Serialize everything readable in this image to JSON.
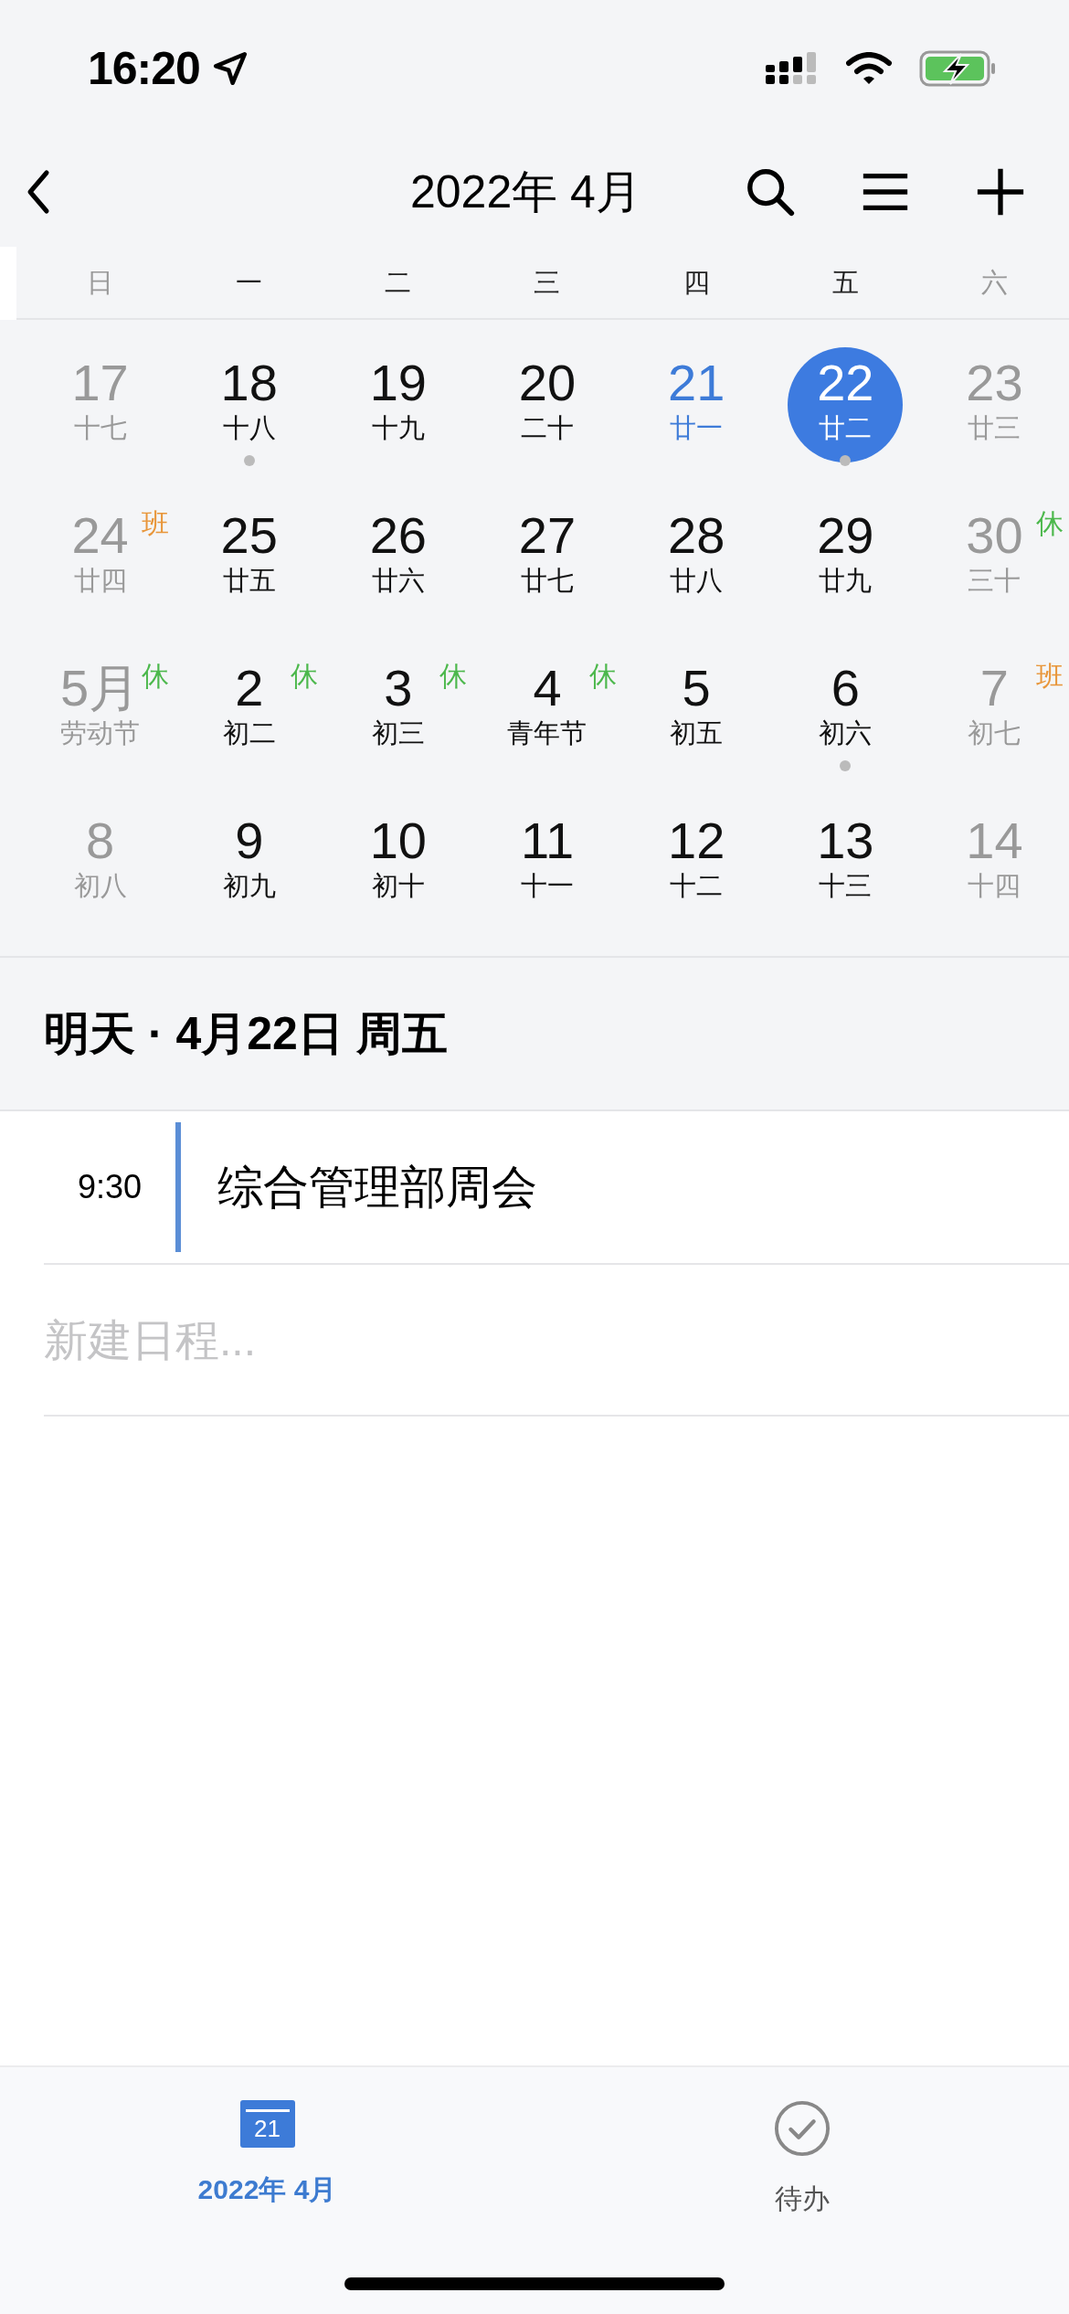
{
  "status_bar": {
    "time": "16:20"
  },
  "nav_bar": {
    "title": "2022年 4月"
  },
  "weekdays": [
    {
      "label": "日",
      "muted": true
    },
    {
      "label": "一",
      "muted": false
    },
    {
      "label": "二",
      "muted": false
    },
    {
      "label": "三",
      "muted": false
    },
    {
      "label": "四",
      "muted": false
    },
    {
      "label": "五",
      "muted": false
    },
    {
      "label": "六",
      "muted": true
    }
  ],
  "weeks": [
    [
      {
        "day": "17",
        "lunar": "十七",
        "muted": true,
        "today": false,
        "selected": false,
        "has_event": false
      },
      {
        "day": "18",
        "lunar": "十八",
        "muted": false,
        "today": false,
        "selected": false,
        "has_event": true
      },
      {
        "day": "19",
        "lunar": "十九",
        "muted": false,
        "today": false,
        "selected": false,
        "has_event": false
      },
      {
        "day": "20",
        "lunar": "二十",
        "muted": false,
        "today": false,
        "selected": false,
        "has_event": false
      },
      {
        "day": "21",
        "lunar": "廿一",
        "muted": false,
        "today": true,
        "selected": false,
        "has_event": false
      },
      {
        "day": "22",
        "lunar": "廿二",
        "muted": false,
        "today": false,
        "selected": true,
        "has_event": true
      },
      {
        "day": "23",
        "lunar": "廿三",
        "muted": true,
        "today": false,
        "selected": false,
        "has_event": false
      }
    ],
    [
      {
        "day": "24",
        "lunar": "廿四",
        "muted": true,
        "today": false,
        "selected": false,
        "has_event": false,
        "badge": {
          "text": "班",
          "color": "#e8963a"
        }
      },
      {
        "day": "25",
        "lunar": "廿五",
        "muted": false,
        "today": false,
        "selected": false,
        "has_event": false
      },
      {
        "day": "26",
        "lunar": "廿六",
        "muted": false,
        "today": false,
        "selected": false,
        "has_event": false
      },
      {
        "day": "27",
        "lunar": "廿七",
        "muted": false,
        "today": false,
        "selected": false,
        "has_event": false
      },
      {
        "day": "28",
        "lunar": "廿八",
        "muted": false,
        "today": false,
        "selected": false,
        "has_event": false
      },
      {
        "day": "29",
        "lunar": "廿九",
        "muted": false,
        "today": false,
        "selected": false,
        "has_event": false
      },
      {
        "day": "30",
        "lunar": "三十",
        "muted": true,
        "today": false,
        "selected": false,
        "has_event": false,
        "badge": {
          "text": "休",
          "color": "#4cb84c"
        }
      }
    ],
    [
      {
        "day": "5月",
        "lunar": "劳动节",
        "muted": true,
        "today": false,
        "selected": false,
        "has_event": false,
        "badge": {
          "text": "休",
          "color": "#4cb84c"
        }
      },
      {
        "day": "2",
        "lunar": "初二",
        "muted": false,
        "today": false,
        "selected": false,
        "has_event": false,
        "badge": {
          "text": "休",
          "color": "#4cb84c"
        }
      },
      {
        "day": "3",
        "lunar": "初三",
        "muted": false,
        "today": false,
        "selected": false,
        "has_event": false,
        "badge": {
          "text": "休",
          "color": "#4cb84c"
        }
      },
      {
        "day": "4",
        "lunar": "青年节",
        "muted": false,
        "today": false,
        "selected": false,
        "has_event": false,
        "badge": {
          "text": "休",
          "color": "#4cb84c"
        }
      },
      {
        "day": "5",
        "lunar": "初五",
        "muted": false,
        "today": false,
        "selected": false,
        "has_event": false
      },
      {
        "day": "6",
        "lunar": "初六",
        "muted": false,
        "today": false,
        "selected": false,
        "has_event": true
      },
      {
        "day": "7",
        "lunar": "初七",
        "muted": true,
        "today": false,
        "selected": false,
        "has_event": false,
        "badge": {
          "text": "班",
          "color": "#e8963a"
        }
      }
    ],
    [
      {
        "day": "8",
        "lunar": "初八",
        "muted": true,
        "today": false,
        "selected": false,
        "has_event": false
      },
      {
        "day": "9",
        "lunar": "初九",
        "muted": false,
        "today": false,
        "selected": false,
        "has_event": false
      },
      {
        "day": "10",
        "lunar": "初十",
        "muted": false,
        "today": false,
        "selected": false,
        "has_event": false
      },
      {
        "day": "11",
        "lunar": "十一",
        "muted": false,
        "today": false,
        "selected": false,
        "has_event": false
      },
      {
        "day": "12",
        "lunar": "十二",
        "muted": false,
        "today": false,
        "selected": false,
        "has_event": false
      },
      {
        "day": "13",
        "lunar": "十三",
        "muted": false,
        "today": false,
        "selected": false,
        "has_event": false
      },
      {
        "day": "14",
        "lunar": "十四",
        "muted": true,
        "today": false,
        "selected": false,
        "has_event": false
      }
    ]
  ],
  "agenda": {
    "heading": "明天 · 4月22日 周五",
    "events": [
      {
        "time": "9:30",
        "title": "综合管理部周会",
        "color": "#5b8ed6"
      }
    ],
    "new_event": {
      "placeholder": "新建日程..."
    }
  },
  "tab_bar": [
    {
      "kind": "calendar",
      "icon_text": "21",
      "label": "2022年 4月",
      "selected": true
    },
    {
      "kind": "todo",
      "label": "待办",
      "selected": false
    }
  ]
}
